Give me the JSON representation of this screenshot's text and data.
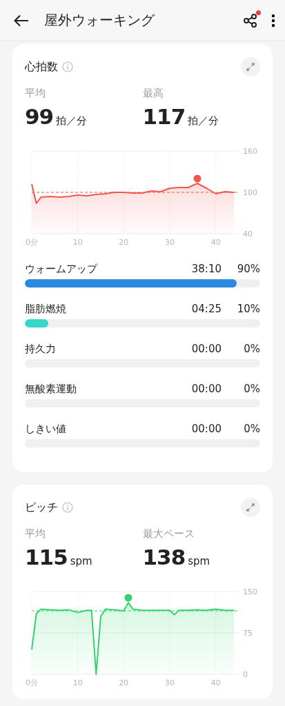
{
  "header": {
    "title": "屋外ウォーキング",
    "share_notification": true
  },
  "heart_rate": {
    "title": "心拍数",
    "stats": [
      {
        "label": "平均",
        "value": "99",
        "unit": "拍／分"
      },
      {
        "label": "最高",
        "value": "117",
        "unit": "拍／分"
      }
    ],
    "chart_data": {
      "type": "area",
      "x": [
        0,
        1,
        2,
        4,
        6,
        8,
        10,
        12,
        14,
        16,
        18,
        20,
        22,
        24,
        26,
        28,
        30,
        32,
        34,
        36,
        38,
        40,
        42,
        44
      ],
      "series": [
        {
          "color": "#f0574a",
          "values": [
            112,
            84,
            93,
            94,
            93,
            94,
            96,
            95,
            97,
            98,
            100,
            100,
            99,
            99,
            102,
            101,
            106,
            107,
            107,
            113,
            106,
            98,
            101,
            100
          ]
        }
      ],
      "grid": "x",
      "xlim": [
        0,
        45
      ],
      "ylim": [
        40,
        160
      ],
      "xticks": [
        {
          "value": 0,
          "label": "0分"
        },
        10,
        20,
        30,
        40
      ],
      "yticks": [
        40,
        100,
        160
      ],
      "ref_lines": [
        {
          "axis": "y",
          "value": 100,
          "color": "#f0574a"
        }
      ]
    },
    "zones": [
      {
        "name": "ウォームアップ",
        "time": "38:10",
        "percent": "90%",
        "level": 0.9,
        "color": "#2b8ae0"
      },
      {
        "name": "脂肪燃焼",
        "time": "04:25",
        "percent": "10%",
        "level": 0.1,
        "color": "#3ad6cb"
      },
      {
        "name": "持久力",
        "time": "00:00",
        "percent": "0%"
      },
      {
        "name": "無酸素運動",
        "time": "00:00",
        "percent": "0%"
      },
      {
        "name": "しきい値",
        "time": "00:00",
        "percent": "0%"
      }
    ]
  },
  "cadence": {
    "title": "ピッチ",
    "stats": [
      {
        "label": "平均",
        "value": "115",
        "unit": "spm"
      },
      {
        "label": "最大ペース",
        "value": "138",
        "unit": "spm"
      }
    ],
    "chart_data": {
      "type": "area",
      "x": [
        0,
        1,
        2,
        4,
        6,
        8,
        10,
        12,
        13,
        14,
        15,
        16,
        18,
        20,
        21,
        22,
        24,
        26,
        28,
        30,
        31,
        32,
        34,
        36,
        38,
        40,
        42,
        44
      ],
      "series": [
        {
          "color": "#2fd46a",
          "values": [
            45,
            110,
            118,
            117,
            116,
            117,
            112,
            116,
            116,
            0,
            105,
            118,
            117,
            115,
            130,
            118,
            116,
            116,
            116,
            116,
            108,
            116,
            116,
            117,
            116,
            118,
            116,
            116
          ]
        }
      ],
      "grid": "x",
      "xlim": [
        0,
        45
      ],
      "ylim": [
        0,
        150
      ],
      "xticks": [
        {
          "value": 0,
          "label": "0分"
        },
        10,
        20,
        30,
        40
      ],
      "yticks": [
        0,
        75,
        150
      ],
      "ref_lines": [
        {
          "axis": "y",
          "value": 115,
          "color": "#2fd46a"
        },
        {
          "axis": "y",
          "value": 75,
          "color": "#ececec"
        }
      ]
    }
  }
}
